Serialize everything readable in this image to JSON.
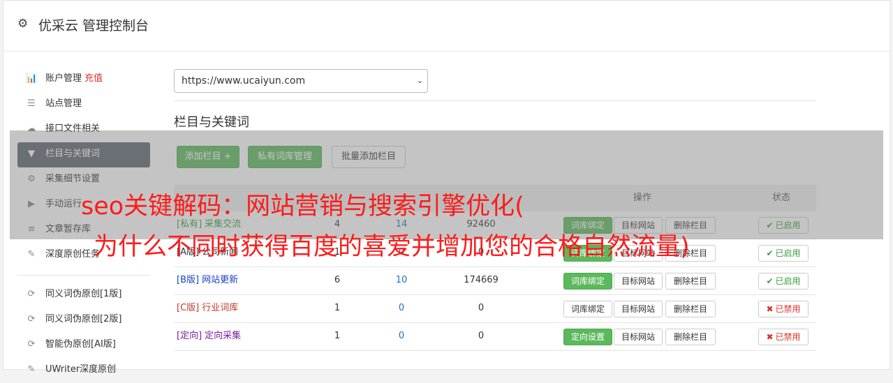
{
  "app": {
    "title": "优采云 管理控制台",
    "icon": "gear-icon"
  },
  "sidebar": {
    "items": [
      {
        "icon": "bar-chart-icon",
        "glyph": "📊",
        "label": "账户管理",
        "extra": "充值",
        "active": false
      },
      {
        "icon": "server-icon",
        "glyph": "☰",
        "label": "站点管理",
        "active": false
      },
      {
        "icon": "cloud-upload-icon",
        "glyph": "☁",
        "label": "接口文件相关",
        "active": false
      },
      {
        "icon": "filter-icon",
        "glyph": "▼",
        "label": "栏目与关键词",
        "active": true
      },
      {
        "icon": "cogs-icon",
        "glyph": "⚙",
        "label": "采集细节设置",
        "active": false
      },
      {
        "icon": "play-circle-icon",
        "glyph": "▶",
        "label": "手动运行",
        "active": false
      },
      {
        "icon": "database-icon",
        "glyph": "≡",
        "label": "文章暂存库",
        "active": false
      },
      {
        "icon": "edit-icon",
        "glyph": "✎",
        "label": "深度原创任务",
        "active": false
      }
    ],
    "items2": [
      {
        "icon": "refresh-icon",
        "glyph": "⟳",
        "label": "同义词伪原创[1版]"
      },
      {
        "icon": "refresh-icon",
        "glyph": "⟳",
        "label": "同义词伪原创[2版]"
      },
      {
        "icon": "refresh-icon",
        "glyph": "⟳",
        "label": "智能伪原创[AI版]"
      },
      {
        "icon": "edit-icon",
        "glyph": "✎",
        "label": "UWriter深度原创"
      }
    ]
  },
  "main": {
    "site_select": {
      "value": "https://www.ucaiyun.com"
    },
    "section_title": "栏目与关键词",
    "toolbar": {
      "add_column": "添加栏目 +",
      "private_lib": "私有词库管理",
      "batch_add": "批量添加栏目"
    },
    "table": {
      "headers": {
        "ops": "操作",
        "status": "状态"
      },
      "rows": [
        {
          "tag": "[私有]",
          "name": "采集交流",
          "tag_color": "#3c9a3c",
          "c1": "4",
          "c2": "14",
          "c3": "92460",
          "bind": "词库绑定",
          "bind_green": true,
          "status": "已启用",
          "enabled": true
        },
        {
          "tag": "[A版]",
          "name": "公司新闻",
          "tag_color": "#333333",
          "c1": "1",
          "c2": "0",
          "c3": "0",
          "bind": "词库绑定",
          "bind_green": true,
          "status": "已启用",
          "enabled": true
        },
        {
          "tag": "[B版]",
          "name": "网站更新",
          "tag_color": "#1a3fc4",
          "c1": "6",
          "c2": "10",
          "c3": "174669",
          "bind": "词库绑定",
          "bind_green": true,
          "status": "已启用",
          "enabled": true
        },
        {
          "tag": "[C版]",
          "name": "行业词库",
          "tag_color": "#c0392b",
          "c1": "1",
          "c2": "0",
          "c3": "0",
          "bind": "词库绑定",
          "bind_green": false,
          "status": "已禁用",
          "enabled": false
        },
        {
          "tag": "[定向]",
          "name": "定向采集",
          "tag_color": "#7b1fa2",
          "c1": "1",
          "c2": "0",
          "c3": "0",
          "bind": "定向设置",
          "bind_green": true,
          "status": "已禁用",
          "enabled": false
        }
      ],
      "target_site": "目标网站",
      "delete_column": "删除栏目"
    }
  },
  "overlay": {
    "line1": "seo关键解码：网站营销与搜索引擎优化(",
    "line2": "为什么不同时获得百度的喜爱并增加您的合格自然流量)"
  },
  "colors": {
    "green": "#5cb85c",
    "link": "#1a6fc4",
    "danger": "#e12f25",
    "sidebar_active": "#5b6570"
  }
}
